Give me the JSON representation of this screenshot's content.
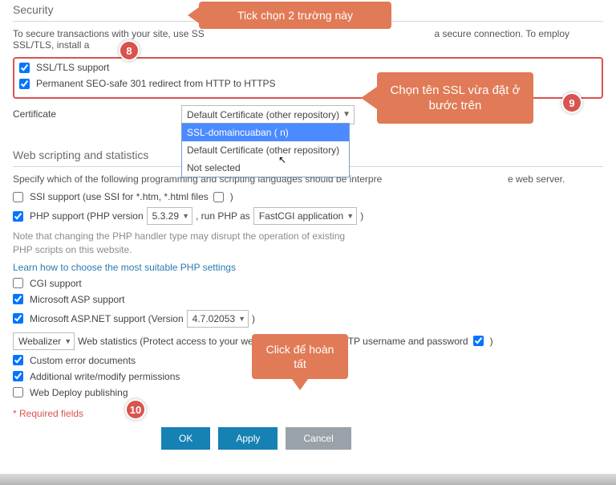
{
  "security": {
    "title": "Security",
    "desc_left": "To secure transactions with your site, use SS",
    "desc_right": "a secure connection. To employ SSL/TLS, install a",
    "ssl_tls": "SSL/TLS support",
    "redirect": "Permanent SEO-safe 301 redirect from HTTP to HTTPS",
    "cert_label": "Certificate",
    "cert_selected": "Default Certificate (other repository)",
    "cert_options": {
      "0": "SSL-domaincuaban (                    n)",
      "1": "Default Certificate (other repository)",
      "2": "Not selected"
    }
  },
  "scripting": {
    "title": "Web scripting and statistics",
    "desc": "Specify which of the following programming and scripting languages should be interpre",
    "desc_tail": "e web server.",
    "ssi": "SSI support (use SSI for *.htm, *.html files",
    "php_support": "PHP support (PHP version",
    "php_ver": "5.3.29",
    "run_php_as": ", run PHP as",
    "php_mode": "FastCGI application",
    "php_close": ")",
    "php_note1": "Note that changing the PHP handler type may disrupt the operation of existing",
    "php_note2": "PHP scripts on this website.",
    "php_link": "Learn how to choose the most suitable PHP settings",
    "cgi": "CGI support",
    "asp": "Microsoft ASP support",
    "aspnet": "Microsoft ASP.NET support (Version",
    "aspnet_ver": "4.7.02053",
    "aspnet_close": ")",
    "webalizer": "Webalizer",
    "webstats": "Web statistics (Protect access to your web statistics with your FTP username and password",
    "webstats_close": ")",
    "custom_err": "Custom error documents",
    "write_mod": "Additional write/modify permissions",
    "webdeploy": "Web Deploy publishing"
  },
  "footer": {
    "required": "* Required fields",
    "ok": "OK",
    "apply": "Apply",
    "cancel": "Cancel"
  },
  "annotations": {
    "tick": "Tick chọn 2 trường này",
    "chon": "Chọn tên SSL vừa đặt ở bước trên",
    "click": "Click để hoàn tất",
    "b8": "8",
    "b9": "9",
    "b10": "10"
  }
}
